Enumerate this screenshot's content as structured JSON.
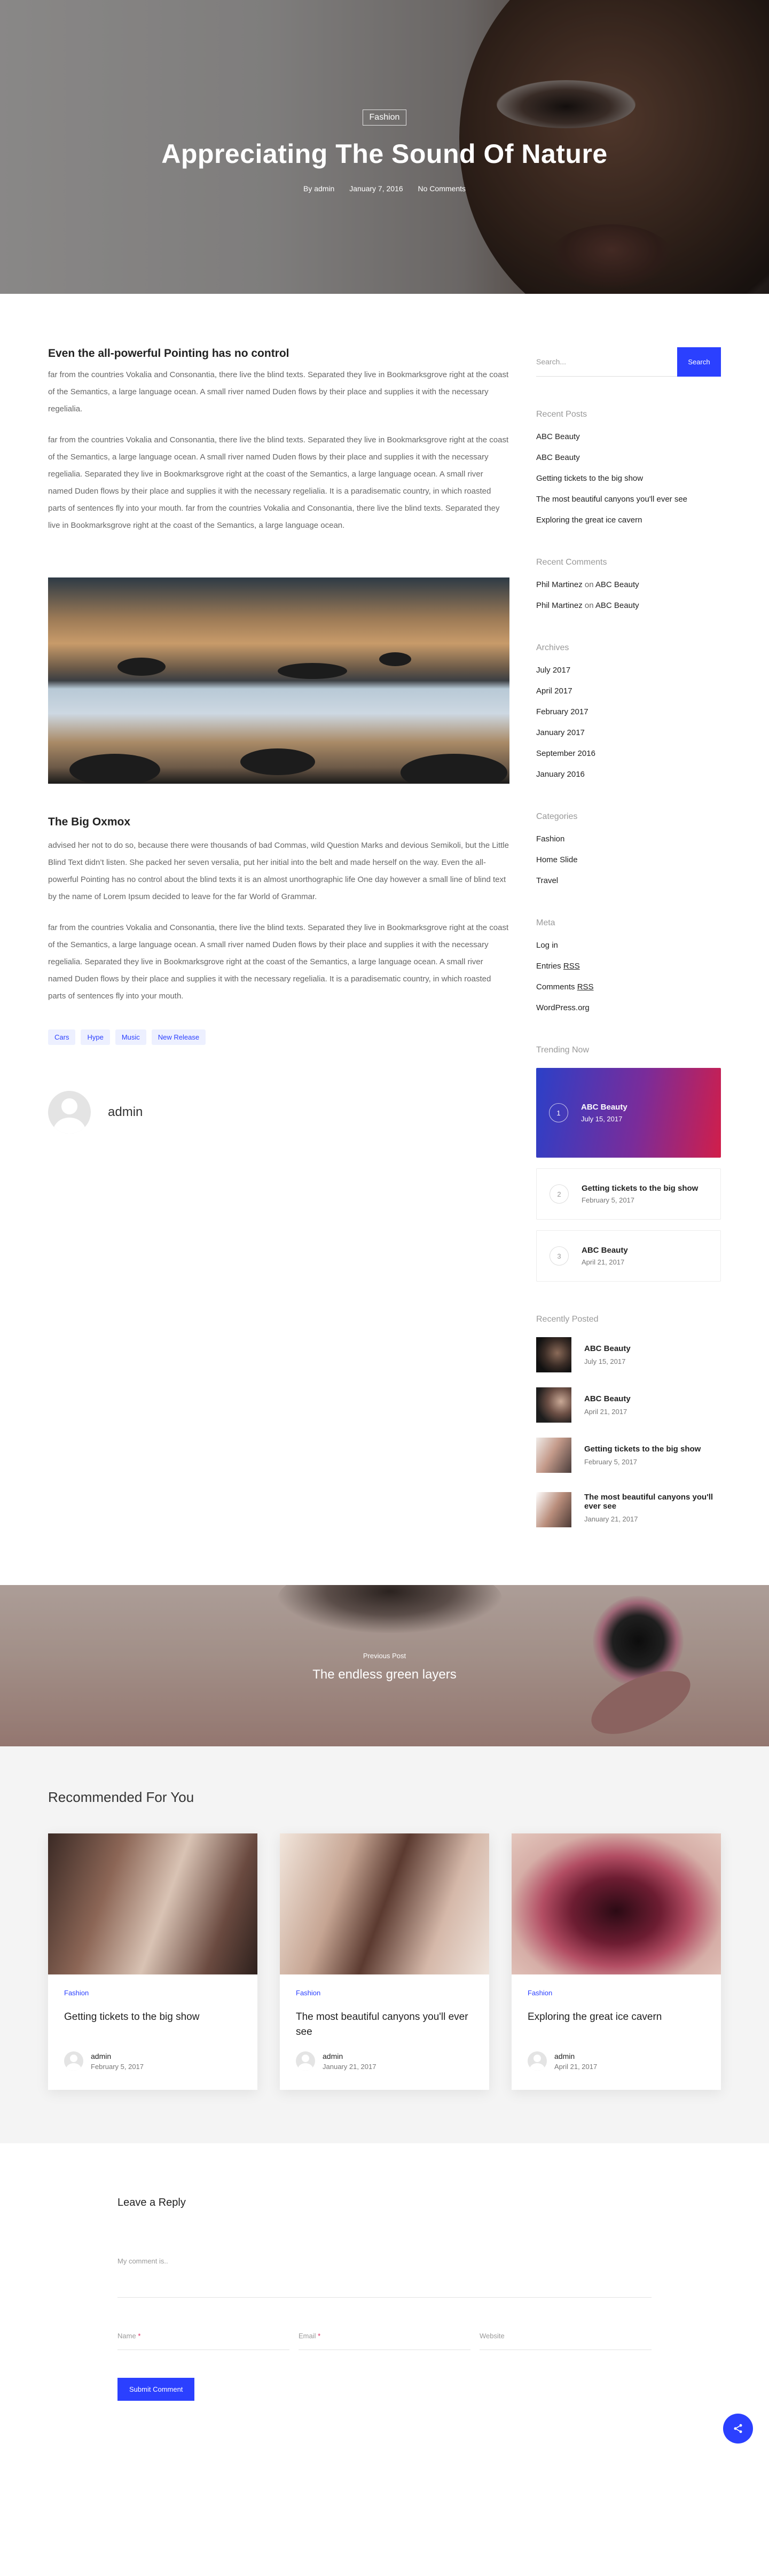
{
  "hero": {
    "category": "Fashion",
    "title": "Appreciating The Sound Of Nature",
    "author": "By admin",
    "date": "January 7, 2016",
    "comments": "No Comments"
  },
  "article": {
    "heading1": "Even the all-powerful Pointing has no control",
    "p1": "far from the countries Vokalia and Consonantia, there live the blind texts. Separated they live in Bookmarksgrove right at the coast of the Semantics, a large language ocean. A small river named Duden flows by their place and supplies it with the necessary regelialia.",
    "p2": "far from the countries Vokalia and Consonantia, there live the blind texts. Separated they live in Bookmarksgrove right at the coast of the Semantics, a large language ocean. A small river named Duden flows by their place and supplies it with the necessary regelialia. Separated they live in Bookmarksgrove right at the coast of the Semantics, a large language ocean. A small river named Duden flows by their place and supplies it with the necessary regelialia. It is a paradisematic country, in which roasted parts of sentences fly into your mouth. far from the countries Vokalia and Consonantia, there live the blind texts. Separated they live in Bookmarksgrove right at the coast of the Semantics, a large language ocean.",
    "heading2": "The Big Oxmox",
    "p3": "advised her not to do so, because there were thousands of bad Commas, wild Question Marks and devious Semikoli, but the Little Blind Text didn’t listen. She packed her seven versalia, put her initial into the belt and made herself on the way.  Even the all-powerful Pointing has no control about the blind texts it is an almost unorthographic life One day however a small line of blind text by the name of Lorem Ipsum decided to leave for the far World of Grammar.",
    "p4": "far from the countries Vokalia and Consonantia, there live the blind texts. Separated they live in Bookmarksgrove right at the coast of the Semantics, a large language ocean. A small river named Duden flows by their place and supplies it with the necessary regelialia. Separated they live in Bookmarksgrove right at the coast of the Semantics, a large language ocean. A small river named Duden flows by their place and supplies it with the necessary regelialia. It is a paradisematic country, in which roasted parts of sentences fly into your mouth.",
    "tags": [
      "Cars",
      "Hype",
      "Music",
      "New Release"
    ],
    "author_name": "admin"
  },
  "sidebar": {
    "search_placeholder": "Search...",
    "search_button": "Search",
    "recent_posts_title": "Recent Posts",
    "recent_posts": [
      "ABC Beauty",
      "ABC Beauty",
      "Getting tickets to the big show",
      "The most beautiful canyons you'll ever see",
      "Exploring the great ice cavern"
    ],
    "recent_comments_title": "Recent Comments",
    "recent_comments": [
      {
        "author": "Phil Martinez",
        "on": "on",
        "post": "ABC Beauty"
      },
      {
        "author": "Phil Martinez",
        "on": "on",
        "post": "ABC Beauty"
      }
    ],
    "archives_title": "Archives",
    "archives": [
      "July 2017",
      "April 2017",
      "February 2017",
      "January 2017",
      "September 2016",
      "January 2016"
    ],
    "categories_title": "Categories",
    "categories": [
      "Fashion",
      "Home Slide",
      "Travel"
    ],
    "meta_title": "Meta",
    "meta": {
      "login": "Log in",
      "entries_prefix": "Entries",
      "comments_prefix": "Comments",
      "rss": "RSS",
      "wordpress": "WordPress.org"
    },
    "trending_title": "Trending Now",
    "trending": [
      {
        "num": "1",
        "title": "ABC Beauty",
        "date": "July 15, 2017"
      },
      {
        "num": "2",
        "title": "Getting tickets to the big show",
        "date": "February 5, 2017"
      },
      {
        "num": "3",
        "title": "ABC Beauty",
        "date": "April 21, 2017"
      }
    ],
    "recently_posted_title": "Recently Posted",
    "recently_posted": [
      {
        "title": "ABC Beauty",
        "date": "July 15, 2017"
      },
      {
        "title": "ABC Beauty",
        "date": "April 21, 2017"
      },
      {
        "title": "Getting tickets to the big show",
        "date": "February 5, 2017"
      },
      {
        "title": "The most beautiful canyons you'll ever see",
        "date": "January 21, 2017"
      }
    ]
  },
  "previous_post": {
    "label": "Previous Post",
    "title": "The endless green layers"
  },
  "recommended": {
    "title": "Recommended For You",
    "cards": [
      {
        "category": "Fashion",
        "title": "Getting tickets to the big show",
        "author": "admin",
        "date": "February 5, 2017"
      },
      {
        "category": "Fashion",
        "title": "The most beautiful canyons you'll ever see",
        "author": "admin",
        "date": "January 21, 2017"
      },
      {
        "category": "Fashion",
        "title": "Exploring the great ice cavern",
        "author": "admin",
        "date": "April 21, 2017"
      }
    ]
  },
  "reply": {
    "title": "Leave a Reply",
    "comment_placeholder": "My comment is..",
    "name_label": "Name",
    "email_label": "Email",
    "required_mark": "*",
    "website_label": "Website",
    "submit_label": "Submit Comment"
  },
  "colors": {
    "accent": "#2b40ff",
    "tag_bg": "#edf0ff"
  },
  "icons": {
    "share": "share-icon"
  }
}
